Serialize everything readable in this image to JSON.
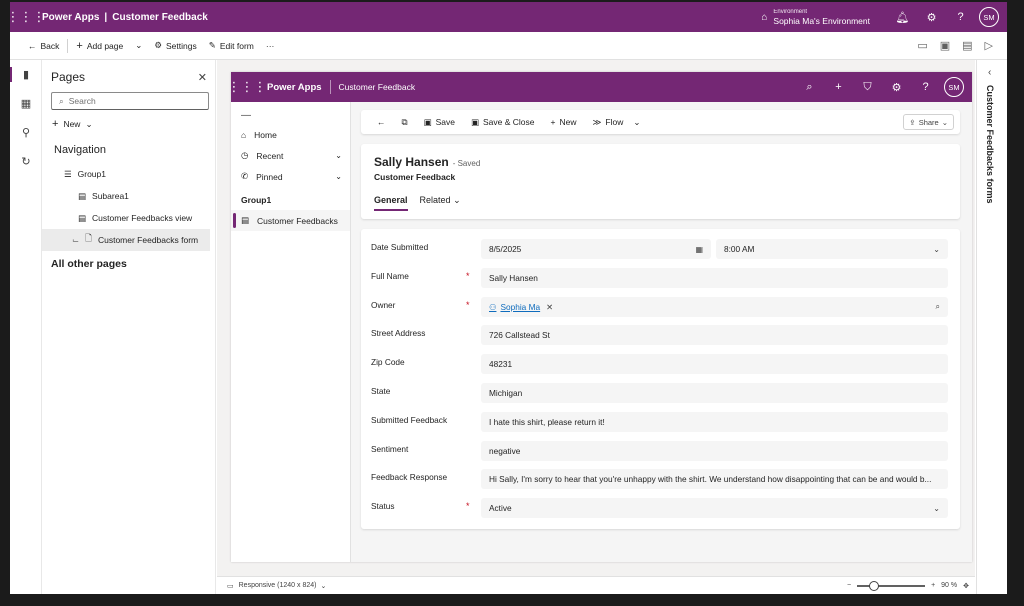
{
  "topbar": {
    "app": "Power Apps",
    "divider": "|",
    "title": "Customer Feedback",
    "env_label": "Environment",
    "env_name": "Sophia Ma's Environment",
    "avatar": "SM"
  },
  "cmdbar": {
    "back": "Back",
    "add_page": "Add page",
    "settings": "Settings",
    "edit_form": "Edit form",
    "more": "···"
  },
  "pages_panel": {
    "title": "Pages",
    "search_placeholder": "Search",
    "new_label": "New",
    "navigation_heading": "Navigation",
    "tree": [
      {
        "label": "Group1"
      },
      {
        "label": "Subarea1"
      },
      {
        "label": "Customer Feedbacks view"
      },
      {
        "label": "Customer Feedbacks form"
      }
    ],
    "all_other_pages": "All other pages"
  },
  "right_panel": {
    "title": "Customer Feedbacks forms"
  },
  "statusbar": {
    "responsive": "Responsive (1240 x 824)",
    "zoom": "90 %"
  },
  "inner_app": {
    "title": "Power Apps",
    "entity": "Customer Feedback",
    "avatar": "SM",
    "sitemap": {
      "home": "Home",
      "recent": "Recent",
      "pinned": "Pinned",
      "group": "Group1",
      "active_item": "Customer Feedbacks"
    },
    "form_cmd": {
      "save": "Save",
      "save_close": "Save & Close",
      "new": "New",
      "flow": "Flow",
      "share": "Share"
    },
    "header": {
      "name": "Sally Hansen",
      "saved": "- Saved",
      "entity": "Customer Feedback"
    },
    "tabs": [
      {
        "label": "General"
      },
      {
        "label": "Related"
      }
    ],
    "fields": {
      "date_submitted": {
        "label": "Date Submitted",
        "date": "8/5/2025",
        "time": "8:00 AM"
      },
      "full_name": {
        "label": "Full Name",
        "value": "Sally Hansen"
      },
      "owner": {
        "label": "Owner",
        "value": "Sophia Ma"
      },
      "street": {
        "label": "Street Address",
        "value": "726 Callstead St"
      },
      "zip": {
        "label": "Zip Code",
        "value": "48231"
      },
      "state": {
        "label": "State",
        "value": "Michigan"
      },
      "submitted_feedback": {
        "label": "Submitted Feedback",
        "value": "I hate this shirt, please return it!"
      },
      "sentiment": {
        "label": "Sentiment",
        "value": "negative"
      },
      "feedback_response": {
        "label": "Feedback Response",
        "value": "Hi Sally, I'm sorry to hear that you're unhappy with the shirt. We understand how disappointing that can be and would b..."
      },
      "status": {
        "label": "Status",
        "value": "Active"
      }
    }
  },
  "colors": {
    "brand": "#742774",
    "link": "#0f6cbd",
    "required": "#c50f1f"
  }
}
